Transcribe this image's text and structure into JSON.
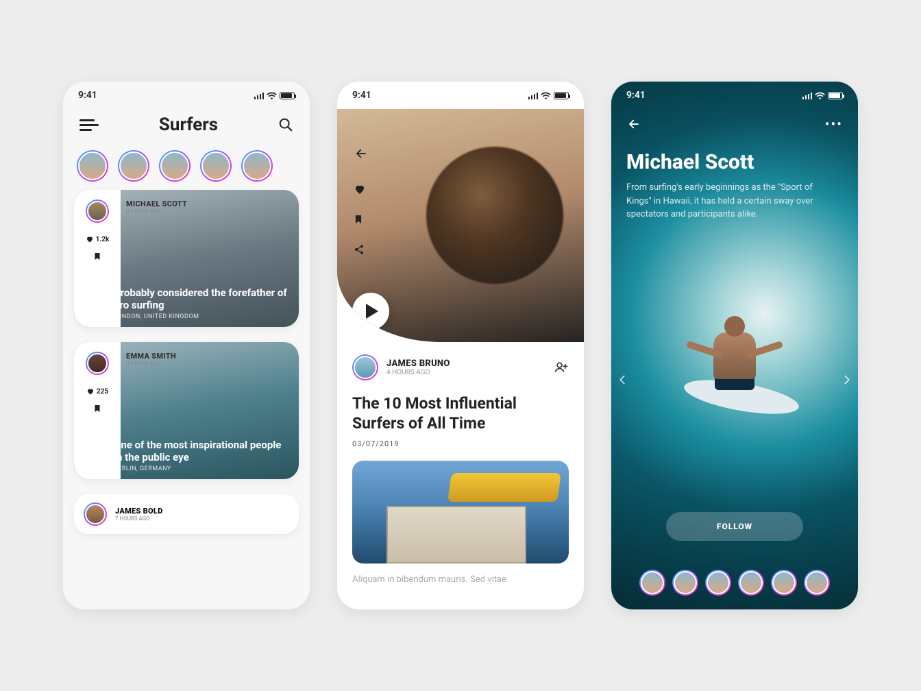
{
  "status_time": "9:41",
  "screen1": {
    "title": "Surfers",
    "cards": [
      {
        "author": "MICHAEL SCOTT",
        "time": "4 HOURS AGO",
        "likes": "1.2k",
        "headline": "Probably considered the forefather of pro surfing",
        "location": "LONDON, UNITED KINGDOM"
      },
      {
        "author": "EMMA SMITH",
        "time": "3 HOURS AGO",
        "likes": "225",
        "headline": "One of the most inspirational people in the public eye",
        "location": "BERLIN, GERMANY"
      },
      {
        "author": "JAMES BOLD",
        "time": "7 HOURS AGO"
      }
    ]
  },
  "screen2": {
    "author": "JAMES BRUNO",
    "time": "4 HOURS AGO",
    "title": "The 10 Most Influential Surfers of All Time",
    "date": "03/07/2019",
    "body": "Aliquam in bibendum mauris. Sed vitae"
  },
  "screen3": {
    "name": "Michael Scott",
    "desc": "From surfing's early beginnings as the \"Sport of Kings\" in Hawaii, it has held a certain sway over spectators and participants alike.",
    "follow": "FOLLOW"
  }
}
